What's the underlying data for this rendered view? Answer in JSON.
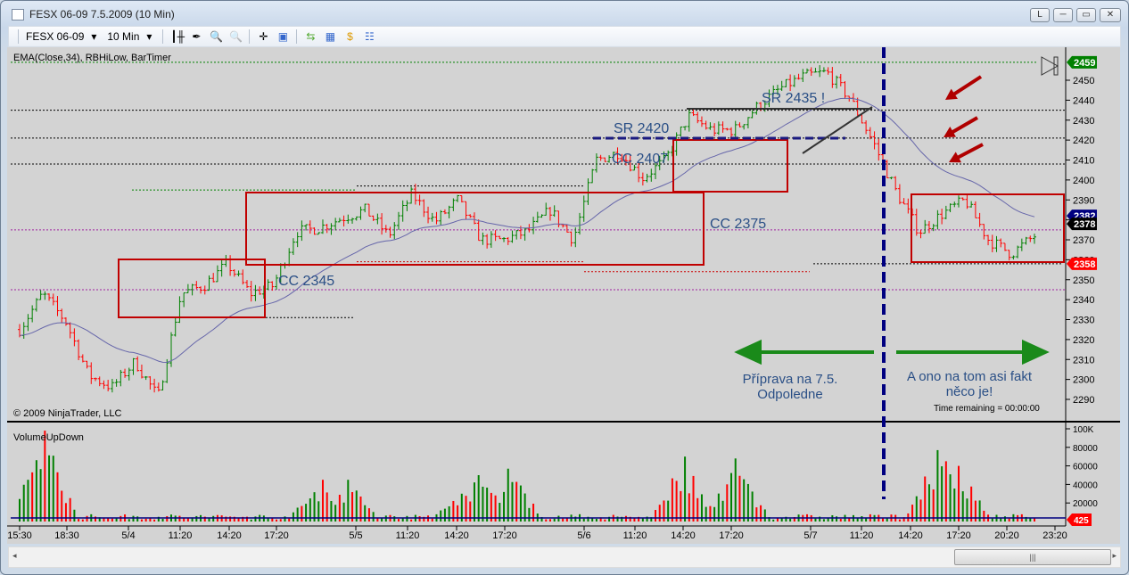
{
  "window": {
    "title": "FESX 06-09  7.5.2009 (10 Min)",
    "buttons": [
      "L",
      "─",
      "▭",
      "✕"
    ]
  },
  "toolbar": {
    "instrument": "FESX 06-09",
    "interval": "10 Min"
  },
  "panels": {
    "price_label": "EMA(Close,34), RBHiLow, BarTimer",
    "volume_label": "VolumeUpDown",
    "copyright": "© 2009 NinjaTrader, LLC",
    "time_remaining": "Time remaining = 00:00:00"
  },
  "colors": {
    "up": "#008000",
    "down": "#ff0000",
    "ema": "#6666aa",
    "box": "#c00000",
    "arrow_green": "#1a8a1a",
    "divider": "#000080",
    "panel_bg": "#d3d3d3"
  },
  "annotations": {
    "sr2435": "SR 2435 !",
    "sr2420": "SR 2420",
    "cc2407": "CC 2407",
    "cc2375": "CC 2375",
    "cc2345": "CC 2345",
    "left_text_1": "Příprava na 7.5.",
    "left_text_2": "Odpoledne",
    "right_text_1": "A ono na tom asi fakt",
    "right_text_2": "něco je!"
  },
  "chart_data": {
    "type": "candlestick",
    "y_ticks": [
      2290,
      2300,
      2310,
      2320,
      2330,
      2340,
      2350,
      2360,
      2370,
      2380,
      2390,
      2400,
      2410,
      2420,
      2430,
      2440,
      2450
    ],
    "ylim": [
      2283,
      2465
    ],
    "price_markers": [
      {
        "label": "2459",
        "value": 2459,
        "color": "#008000"
      },
      {
        "label": "2382",
        "value": 2382,
        "color": "#000080"
      },
      {
        "label": "2378",
        "value": 2378,
        "color": "#000000"
      },
      {
        "label": "2358",
        "value": 2358,
        "color": "#ff0000"
      }
    ],
    "close_path": [
      2325,
      2343,
      2329,
      2302,
      2296,
      2309,
      2291,
      2343,
      2347,
      2358,
      2343,
      2347,
      2374,
      2376,
      2381,
      2385,
      2372,
      2393,
      2379,
      2390,
      2370,
      2370,
      2374,
      2385,
      2370,
      2410,
      2414,
      2401,
      2410,
      2432,
      2425,
      2425,
      2437,
      2446,
      2452,
      2454,
      2441,
      2419,
      2394,
      2374,
      2383,
      2390,
      2370,
      2363,
      2372
    ],
    "x_labels": [
      "15:30",
      "18:30",
      "5/4",
      "11:20",
      "14:20",
      "17:20",
      "5/5",
      "11:20",
      "14:20",
      "17:20",
      "5/6",
      "11:20",
      "14:20",
      "17:20",
      "5/7",
      "11:20",
      "14:20",
      "17:20",
      "20:20",
      "23:20"
    ],
    "volume": {
      "y_ticks": [
        "100K",
        "80000",
        "60000",
        "40000",
        "20000"
      ],
      "ylim": [
        0,
        100000
      ],
      "last_marker": "425",
      "peaks": [
        {
          "label": "18:30",
          "value": 98000
        },
        {
          "label": "17:20",
          "value": 45000
        },
        {
          "label": "17:20",
          "value": 57000
        },
        {
          "label": "14:20",
          "value": 70000
        },
        {
          "label": "17:20",
          "value": 68000
        },
        {
          "label": "17:20",
          "value": 77000
        }
      ]
    },
    "ema_period": 34
  }
}
